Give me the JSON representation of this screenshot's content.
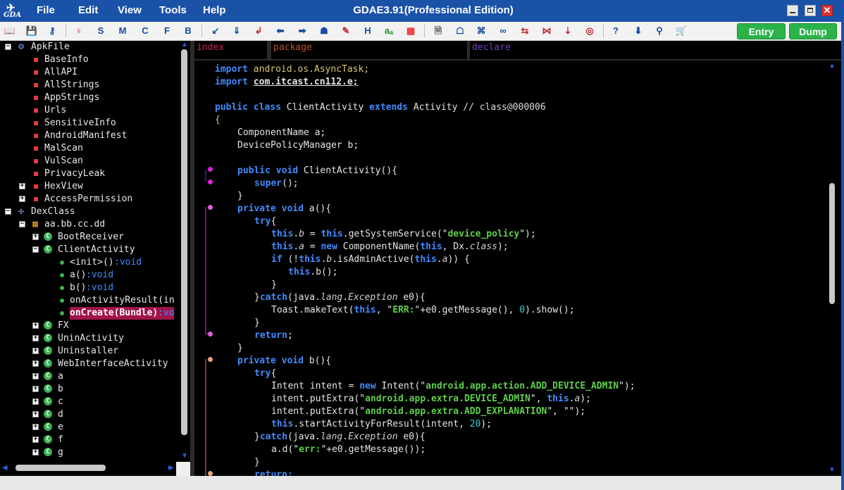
{
  "app": {
    "title": "GDAE3.91(Professional Edition)",
    "logo_text": "GDA",
    "menu": [
      "File",
      "Edit",
      "View",
      "Tools",
      "Help"
    ],
    "close_symbol": "✕"
  },
  "toolbar": {
    "letter_buttons": [
      "S",
      "M",
      "C",
      "F",
      "B"
    ],
    "h_button": "H",
    "a_button": "aₐ",
    "help_button": "?",
    "entry_label": "Entry",
    "dump_label": "Dump"
  },
  "tree": {
    "apkfile": "ApkFile",
    "apk_children": [
      "BaseInfo",
      "AllAPI",
      "AllStrings",
      "AppStrings",
      "Urls",
      "SensitiveInfo",
      "AndroidManifest",
      "MalScan",
      "VulScan",
      "PrivacyLeak"
    ],
    "hexview": "HexView",
    "accesspermission": "AccessPermission",
    "dexclass": "DexClass",
    "package": "aa.bb.cc.dd",
    "classes_before": [
      "BootReceiver"
    ],
    "client_activity": "ClientActivity",
    "methods": [
      {
        "name": "<init>()",
        "ret": ":void"
      },
      {
        "name": "a()",
        "ret": ":void"
      },
      {
        "name": "b()",
        "ret": ":void"
      },
      {
        "name": "onActivityResult(in",
        "ret": ""
      },
      {
        "name": "onCreate(Bundle)",
        "ret": ":vo"
      }
    ],
    "classes_after": [
      "FX",
      "UninActivity",
      "Uninstaller",
      "WebInterfaceActivity",
      "a",
      "b",
      "c",
      "d",
      "e",
      "f",
      "g"
    ]
  },
  "tabs": {
    "index": "index",
    "package": "package",
    "declare": "declare"
  },
  "code": {
    "import1_kw": "import",
    "import1_pkg": "android.os.AsyncTask;",
    "import2_kw": "import",
    "import2_pkg": "com.itcast.cn112.e;",
    "class_public": "public",
    "class_kw": "class",
    "class_name": "ClientActivity",
    "extends_kw": "extends",
    "extends_name": "Activity",
    "class_comment": "// class@000006",
    "open_brace": "{",
    "field1": "ComponentName a;",
    "field2": "DevicePolicyManager b;",
    "ctor_mod": "public void",
    "ctor_name": "ClientActivity(){",
    "super_kw": "super",
    "super_rest": "();",
    "close_brace": "}",
    "a_mod": "private void",
    "a_name": "a(){",
    "try_kw": "try",
    "try_brace": "{",
    "this_kw": "this",
    "l1_mid1": ".",
    "l1_field": "b",
    "l1_eq": " = ",
    "l1_call": ".getSystemService(\"",
    "l1_str": "device_policy",
    "l1_end": "\");",
    "l2_field": "a",
    "new_kw": "new",
    "l2_call": " ComponentName(",
    "l2_comma": ", Dx.",
    "class_word": "class",
    "l2_end": ");",
    "if_kw": "if",
    "l3_open": " (!",
    "l3_call": ".isAdminActive(",
    "l3_end": ")) {",
    "l4_call": ".b();",
    "catch_close": "}",
    "catch_kw": "catch",
    "catch_open": "(java.",
    "lang_word": "lang",
    "dot": ".",
    "exception_word": "Exception",
    "catch_end": " e0){",
    "toast_pre": "Toast.",
    "toast_call": "makeText(",
    "toast_comma": ", \"",
    "toast_str": "ERR:",
    "toast_mid": "\"+e0.getMessage(), ",
    "zero": "0",
    "toast_end": ").show();",
    "return_kw": "return",
    "semi": ";",
    "b_mod": "private void",
    "b_name": "b(){",
    "intent_decl": "Intent intent = ",
    "intent_new": " Intent(\"",
    "intent_str": "android.app.action.ADD_DEVICE_ADMIN",
    "intent_end": "\");",
    "put1_pre": "intent.putExtra(\"",
    "put1_str": "android.app.extra.DEVICE_ADMIN",
    "put1_mid": "\", ",
    "put1_end": ");",
    "put2_pre": "intent.putExtra(\"",
    "put2_str": "android.app.extra.ADD_EXPLANATION",
    "put2_end": "\", \"\");",
    "start_call": ".startActivityForResult(intent, ",
    "twenty": "20",
    "start_end": ");",
    "ad_pre": "a.d(\"",
    "ad_str": "err:",
    "ad_end": "\"+e0.getMessage());",
    "last_kw": "return;"
  },
  "colors": {
    "titlebar": "#1a52a8",
    "keyword": "#3f8cff",
    "string": "#5fcf4a",
    "entry": "#2bb34a",
    "selected": "#a0144c"
  }
}
